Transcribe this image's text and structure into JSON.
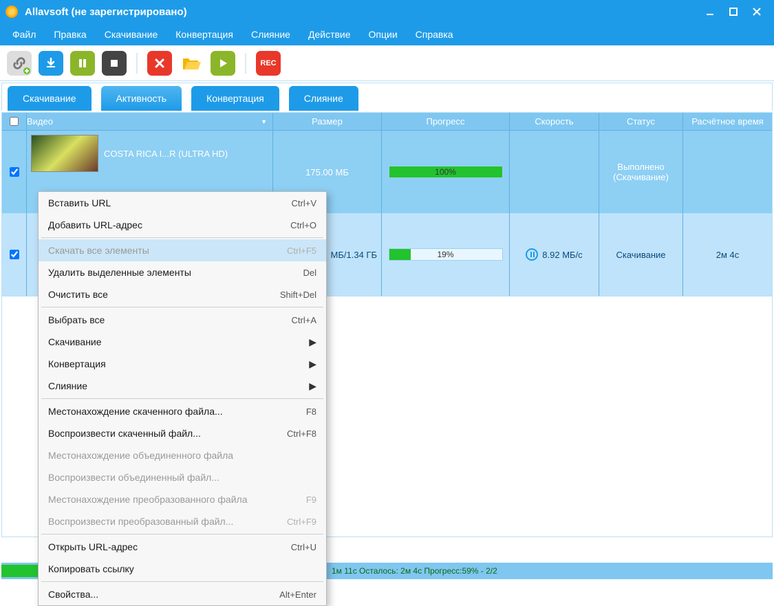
{
  "window": {
    "title": "Allavsoft (не зарегистрировано)"
  },
  "menu": {
    "items": [
      "Файл",
      "Правка",
      "Скачивание",
      "Конвертация",
      "Слияние",
      "Действие",
      "Опции",
      "Справка"
    ]
  },
  "toolbar": {
    "rec": "REC"
  },
  "tabs": {
    "items": [
      "Скачивание",
      "Активность",
      "Конвертация",
      "Слияние"
    ],
    "active": 1
  },
  "columns": {
    "video": "Видео",
    "size": "Размер",
    "progress": "Прогресс",
    "speed": "Скорость",
    "status": "Статус",
    "eta": "Расчётное время"
  },
  "rows": [
    {
      "checked": true,
      "title": "COSTA RICA I...R (ULTRA HD)",
      "size": "175.00 МБ",
      "progress": 100,
      "progress_txt": "100%",
      "speed": "",
      "status": "Выполнено (Скачивание)",
      "eta": ""
    },
    {
      "checked": true,
      "title": "",
      "size": "МБ/1.34 ГБ",
      "progress": 19,
      "progress_txt": "19%",
      "speed": "8.92 МБ/с",
      "status": "Скачивание",
      "eta": "2м  4с"
    }
  ],
  "context_menu": [
    {
      "label": "Вставить URL",
      "shortcut": "Ctrl+V",
      "enabled": true
    },
    {
      "label": "Добавить URL-адрес",
      "shortcut": "Ctrl+O",
      "enabled": true
    },
    {
      "sep": true
    },
    {
      "label": "Скачать все элементы",
      "shortcut": "Ctrl+F5",
      "enabled": false,
      "hover": true
    },
    {
      "label": "Удалить выделенные элементы",
      "shortcut": "Del",
      "enabled": true
    },
    {
      "label": "Очистить все",
      "shortcut": "Shift+Del",
      "enabled": true
    },
    {
      "sep": true
    },
    {
      "label": "Выбрать все",
      "shortcut": "Ctrl+A",
      "enabled": true
    },
    {
      "label": "Скачивание",
      "submenu": true,
      "enabled": true
    },
    {
      "label": "Конвертация",
      "submenu": true,
      "enabled": true
    },
    {
      "label": "Слияние",
      "submenu": true,
      "enabled": true
    },
    {
      "sep": true
    },
    {
      "label": "Местонахождение скаченного файла...",
      "shortcut": "F8",
      "enabled": true
    },
    {
      "label": "Воспроизвести скаченный файл...",
      "shortcut": "Ctrl+F8",
      "enabled": true
    },
    {
      "label": "Местонахождение объединенного файла",
      "enabled": false
    },
    {
      "label": "Воспроизвести объединенный файл...",
      "enabled": false
    },
    {
      "label": "Местонахождение преобразованного файла",
      "shortcut": "F9",
      "enabled": false
    },
    {
      "label": "Воспроизвести преобразованный файл...",
      "shortcut": "Ctrl+F9",
      "enabled": false
    },
    {
      "sep": true
    },
    {
      "label": "Открыть URL-адрес",
      "shortcut": "Ctrl+U",
      "enabled": true
    },
    {
      "label": "Копировать ссылку",
      "enabled": true
    },
    {
      "sep": true
    },
    {
      "label": "Свойства...",
      "shortcut": "Alt+Enter",
      "enabled": true
    }
  ],
  "statusbar": {
    "text": "1м 11с Осталось: 2м  4с Прогресс:59% - 2/2"
  }
}
